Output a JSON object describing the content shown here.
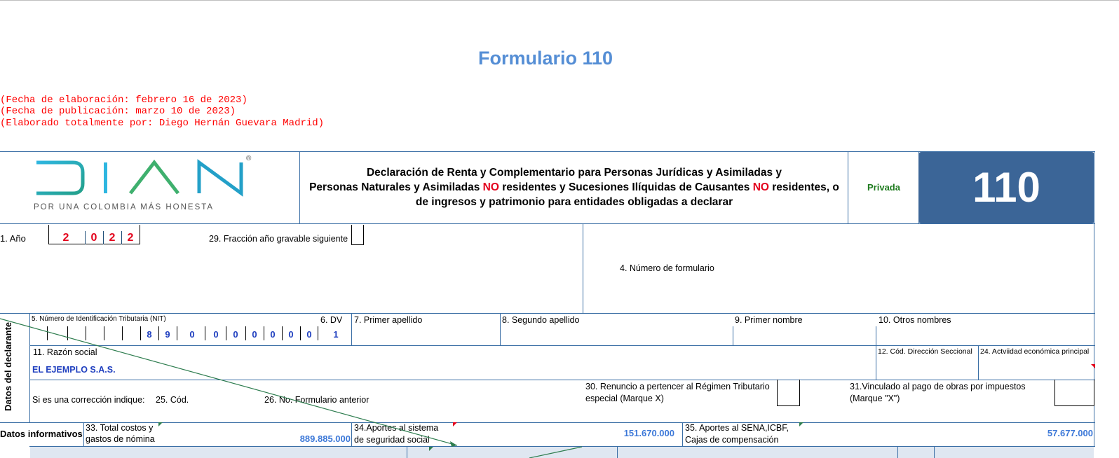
{
  "title": "Formulario 110",
  "notes": [
    "(Fecha de elaboración: febrero 16 de 2023)",
    "(Fecha de publicación: marzo 10 de 2023)",
    "(Elaborado totalmente por: Diego Hernán Guevara Madrid)"
  ],
  "logo": {
    "text": "DIAN",
    "tagline": "POR UNA COLOMBIA MÁS HONESTA",
    "registered": "®"
  },
  "declaration": {
    "line1": "Declaración de Renta y Complementario para Personas Jurídicas y Asimiladas y",
    "line2a": "Personas Naturales y Asimiladas ",
    "no1": "NO",
    "line2b": " residentes y Sucesiones Ilíquidas de Causantes ",
    "no2": "NO",
    "line2c": " residentes, o",
    "line3": "de ingresos y patrimonio para entidades obligadas a declarar"
  },
  "privada": "Privada",
  "form_number": "110",
  "fields": {
    "anio_label": "1. Año",
    "anio_digits": [
      "2",
      "0",
      "2",
      "2"
    ],
    "fraccion_label": "29. Fracción año gravable siguiente",
    "numero_formulario_label": "4. Número de formulario",
    "nit_label": "5. Número de Identificación Tributaria (NIT)",
    "nit_digits": [
      "8",
      "9",
      "0",
      "0",
      "0",
      "0",
      "0",
      "0",
      "0"
    ],
    "dv_label": "6. DV",
    "dv_value": "1",
    "primer_apellido": "7. Primer apellido",
    "segundo_apellido": "8. Segundo apellido",
    "primer_nombre": "9. Primer nombre",
    "otros_nombres": "10. Otros nombres",
    "razon_social_label": "11. Razón social",
    "razon_social_value": "EL EJEMPLO S.A.S.",
    "cod_direccion": "12. Cód. Dirección Seccional",
    "actividad": "24. Actviidad económica principal",
    "correccion": "Si es una corrección indique:",
    "cod": "25.  Cód.",
    "formulario_anterior": "26. No. Formulario anterior",
    "renuncio_1": "30. Renuncio a pertencer al Régimen Tributario",
    "renuncio_2": "especial (Marque X)",
    "vinculado_1": "31.Vinculado  al  pago  de  obras  por  impuestos",
    "vinculado_2": "(Marque \"X\")",
    "datos_declarante": "Datos del declarante",
    "datos_informativos": "Datos informativos",
    "costos_1": "33. Total costos y",
    "costos_2": "gastos de nómina",
    "costos_value": "889.885.000",
    "aportes_1": "34.Aportes  al  sistema",
    "aportes_2": "de     seguridad     social",
    "aportes_value": "151.670.000",
    "sena_1": "35.  Aportes al SENA,ICBF,",
    "sena_2": "Cajas    de    compensación",
    "sena_value": "57.677.000"
  },
  "colors": {
    "title": "#558ed5",
    "border": "#3a6ea5",
    "badge": "#3b6597",
    "notes": "#ff0000",
    "values": "#1f3fbf",
    "amounts": "#3c78d8",
    "privada": "#1e7b1e"
  }
}
